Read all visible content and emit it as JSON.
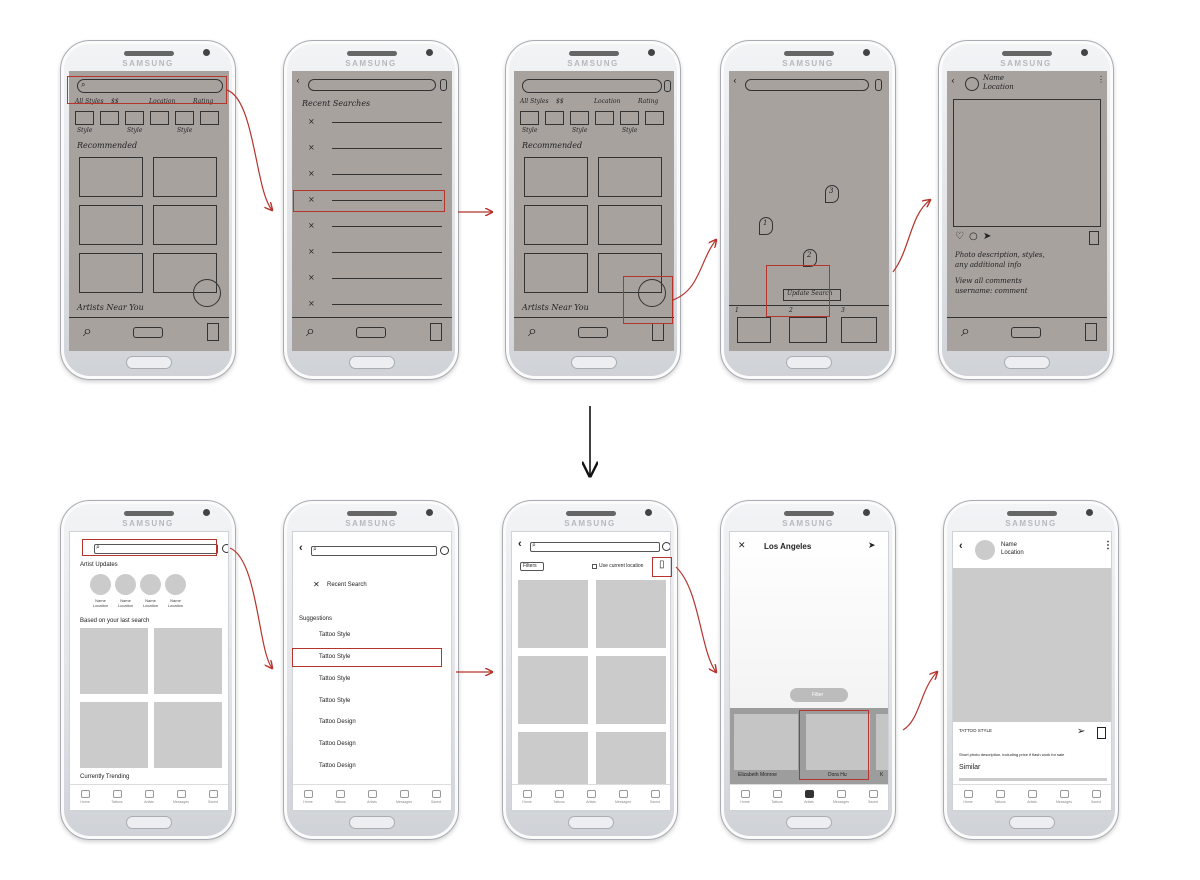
{
  "brand": "SAMSUNG",
  "sketch": {
    "filter_chips": [
      "All Styles",
      "$$",
      "Location",
      "Rating"
    ],
    "style_label": "Style",
    "recommended": "Recommended",
    "artists_near": "Artists Near You",
    "recent_searches": "Recent Searches",
    "pins": [
      "1",
      "2",
      "3"
    ],
    "results_label": "Update Search",
    "card_numbers": [
      "1",
      "2",
      "3"
    ],
    "profile_name": "Name",
    "profile_location": "Location",
    "desc_line1": "Photo description, styles,",
    "desc_line2": "any additional info",
    "view_comments": "View all comments",
    "comment_line": "username: comment"
  },
  "wire": {
    "artist_updates": "Artist Updates",
    "avatar_name": "Name",
    "avatar_location": "Location",
    "based_on": "Based on your last search",
    "trending": "Currently Trending",
    "nav": [
      "Home",
      "Tattoos",
      "Artists",
      "Messages",
      "Saved"
    ],
    "recent_search": "Recent Search",
    "suggestions": "Suggestions",
    "suggestion_items": [
      "Tattoo Style",
      "Tattoo Style",
      "Tattoo Style",
      "Tattoo Style",
      "Tattoo Design",
      "Tattoo Design",
      "Tattoo Design"
    ],
    "filters": "Filters",
    "use_location": "Use current location",
    "map_location": "Los Angeles",
    "filter_btn": "Filter",
    "artist_cards": [
      "Elizabeth Monroe",
      "Dora Hu",
      "K"
    ],
    "profile_name": "Name",
    "profile_location": "Location",
    "tattoo_style": "TATTOO STYLE",
    "short_desc": "Short photo description, including price if flash work for sale",
    "similar": "Similar"
  },
  "colors": {
    "highlight": "#b5342c",
    "sketch_bg": "#a8a29f",
    "placeholder": "#cbcbcb"
  }
}
